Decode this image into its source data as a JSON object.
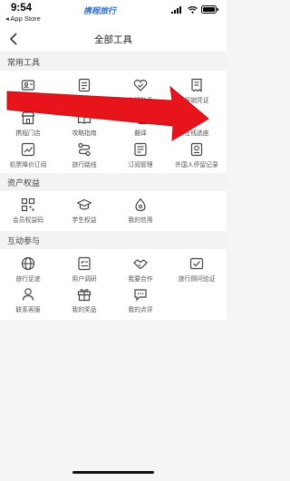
{
  "status_bar": {
    "time": "9:54",
    "back_to_app": "◂ App Store",
    "brand": "携程旅行"
  },
  "nav": {
    "title": "全部工具",
    "back_icon": "chevron-left-icon"
  },
  "sections": [
    {
      "title": "常用工具",
      "tools": [
        {
          "label": "常用信息",
          "icon": "user-card-icon"
        },
        {
          "label": "出行清单",
          "icon": "checklist-icon"
        },
        {
          "label": "航班助手",
          "icon": "heart-check-icon"
        },
        {
          "label": "报销凭证",
          "icon": "receipt-icon"
        },
        {
          "label": "携程门店",
          "icon": "store-icon"
        },
        {
          "label": "攻略指南",
          "icon": "book-icon"
        },
        {
          "label": "翻译",
          "icon": "translate-icon"
        },
        {
          "label": "在线选座",
          "icon": "seat-icon"
        },
        {
          "label": "机票降价订阅",
          "icon": "trend-chart-icon"
        },
        {
          "label": "旅行路线",
          "icon": "route-icon"
        },
        {
          "label": "订阅管理",
          "icon": "subscription-icon"
        },
        {
          "label": "外国人停留记录",
          "icon": "passport-icon"
        }
      ]
    },
    {
      "title": "资产权益",
      "tools": [
        {
          "label": "会员权益码",
          "icon": "qr-code-icon"
        },
        {
          "label": "学生权益",
          "icon": "graduation-cap-icon"
        },
        {
          "label": "我的信用",
          "icon": "credit-drop-icon"
        }
      ]
    },
    {
      "title": "互动参与",
      "tools": [
        {
          "label": "旅行足迹",
          "icon": "footprint-icon"
        },
        {
          "label": "用户调研",
          "icon": "survey-icon"
        },
        {
          "label": "我要合作",
          "icon": "handshake-icon"
        },
        {
          "label": "旅行顾问验证",
          "icon": "advisor-check-icon"
        },
        {
          "label": "联系客服",
          "icon": "customer-service-icon"
        },
        {
          "label": "我的奖品",
          "icon": "gift-icon"
        },
        {
          "label": "我的点评",
          "icon": "comment-icon"
        }
      ]
    }
  ],
  "colors": {
    "arrow": "#e8141c",
    "brand": "#2f6fd8",
    "icon_stroke": "#444444",
    "background": "#f5f5f5"
  }
}
